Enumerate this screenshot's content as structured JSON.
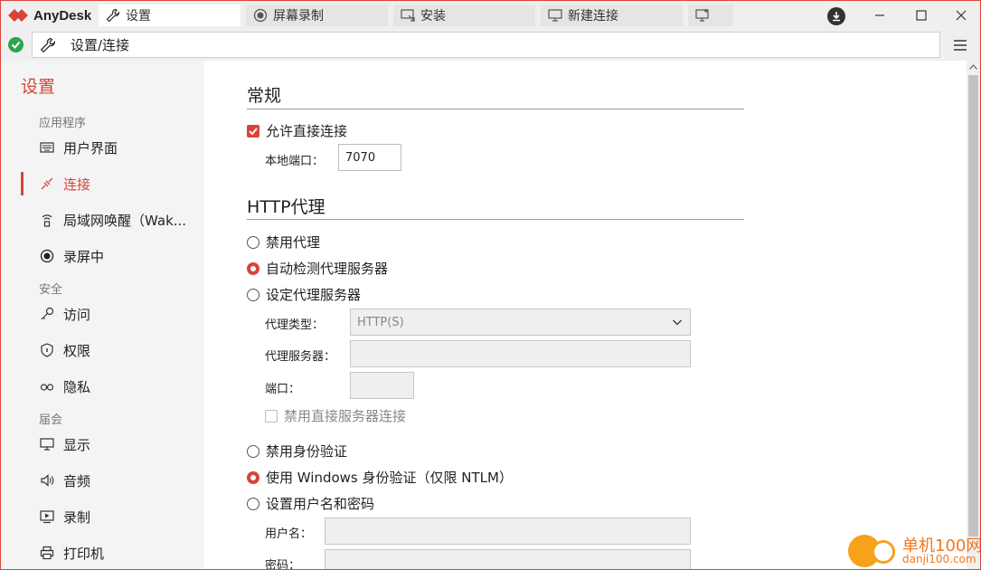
{
  "titlebar": {
    "app_name": "AnyDesk",
    "tabs": [
      {
        "label": "设置",
        "icon": "wrench-icon",
        "active": true
      },
      {
        "label": "屏幕录制",
        "icon": "record-icon",
        "active": false
      },
      {
        "label": "安装",
        "icon": "install-icon",
        "active": false
      },
      {
        "label": "新建连接",
        "icon": "monitor-icon",
        "active": false
      },
      {
        "label": "",
        "icon": "new-session-icon",
        "active": false
      }
    ]
  },
  "addressbar": {
    "path": "设置/连接",
    "status_color": "#2ea44f"
  },
  "sidebar": {
    "title": "设置",
    "sections": {
      "app": "应用程序",
      "security": "安全",
      "session": "届会"
    },
    "items": [
      {
        "label": "用户界面",
        "icon": "keyboard-icon"
      },
      {
        "label": "连接",
        "icon": "connection-icon",
        "active": true
      },
      {
        "label": "局域网唤醒（Wak...",
        "icon": "wake-on-lan-icon"
      },
      {
        "label": "录屏中",
        "icon": "record-icon"
      },
      {
        "label": "访问",
        "icon": "key-icon"
      },
      {
        "label": "权限",
        "icon": "shield-icon"
      },
      {
        "label": "隐私",
        "icon": "glasses-icon"
      },
      {
        "label": "显示",
        "icon": "display-icon"
      },
      {
        "label": "音频",
        "icon": "speaker-icon"
      },
      {
        "label": "录制",
        "icon": "video-icon"
      },
      {
        "label": "打印机",
        "icon": "printer-icon"
      }
    ]
  },
  "main": {
    "general": {
      "heading": "常规",
      "allow_direct": "允许直接连接",
      "local_port_label": "本地端口：",
      "local_port_value": "7070"
    },
    "proxy": {
      "heading": "HTTP代理",
      "disable_proxy": "禁用代理",
      "auto_detect": "自动检测代理服务器",
      "set_proxy": "设定代理服务器",
      "proxy_type_label": "代理类型：",
      "proxy_type_value": "HTTP(S)",
      "proxy_server_label": "代理服务器：",
      "proxy_server_value": "",
      "port_label": "端口：",
      "port_value": "",
      "disable_direct_server": "禁用直接服务器连接",
      "disable_auth": "禁用身份验证",
      "use_windows_auth": "使用 Windows 身份验证（仅限 NTLM）",
      "set_credentials": "设置用户名和密码",
      "username_label": "用户名：",
      "password_label": "密码："
    }
  },
  "watermark": {
    "text": "单机100网",
    "url": "danji100.com"
  },
  "colors": {
    "accent": "#d8443a",
    "watermark": "#f0781e"
  }
}
